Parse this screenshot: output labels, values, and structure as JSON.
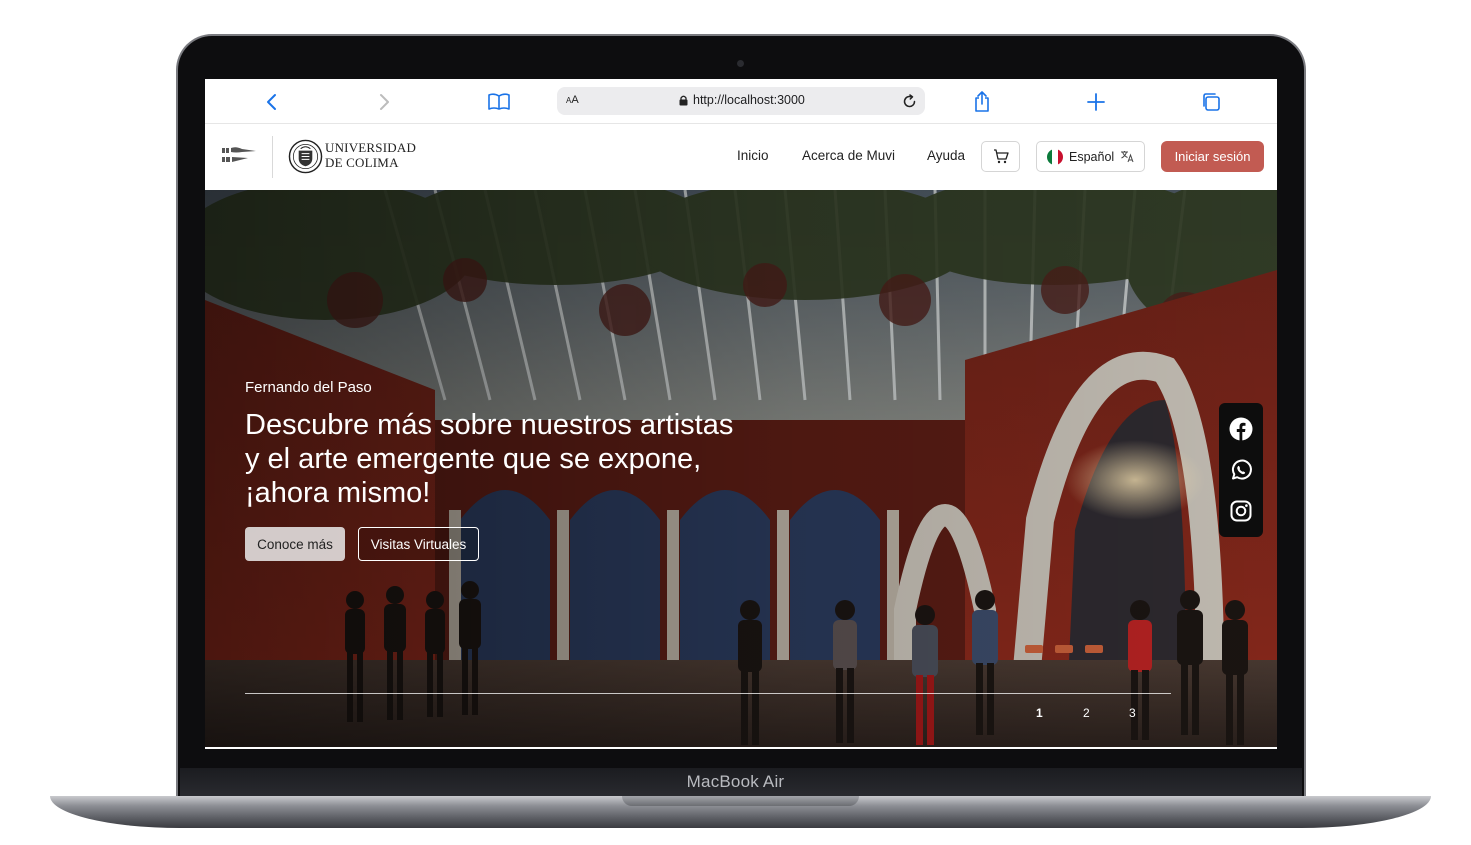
{
  "device": {
    "label": "MacBook Air"
  },
  "browser": {
    "text_size_label": "AA",
    "url": "http://localhost:3000",
    "icons": [
      "back-icon",
      "forward-icon",
      "bookmarks-icon",
      "lock-icon",
      "reload-icon",
      "share-icon",
      "new-tab-icon",
      "tabs-icon"
    ]
  },
  "navbar": {
    "university_name_line1": "UNIVERSIDAD",
    "university_name_line2": "DE COLIMA",
    "links": [
      {
        "label": "Inicio"
      },
      {
        "label": "Acerca de Muvi"
      },
      {
        "label": "Ayuda"
      }
    ],
    "language_label": "Español",
    "login_label": "Iniciar sesión",
    "accent_color": "#c25b52"
  },
  "hero": {
    "kicker": "Fernando del Paso",
    "title": "Descubre más sobre nuestros artistas y el arte emergente que se expone, ¡ahora mismo!",
    "primary_button": "Conoce más",
    "secondary_button": "Visitas Virtuales",
    "pages": [
      "1",
      "2",
      "3"
    ],
    "active_page": "1",
    "social": [
      "facebook-icon",
      "whatsapp-icon",
      "instagram-icon"
    ]
  }
}
